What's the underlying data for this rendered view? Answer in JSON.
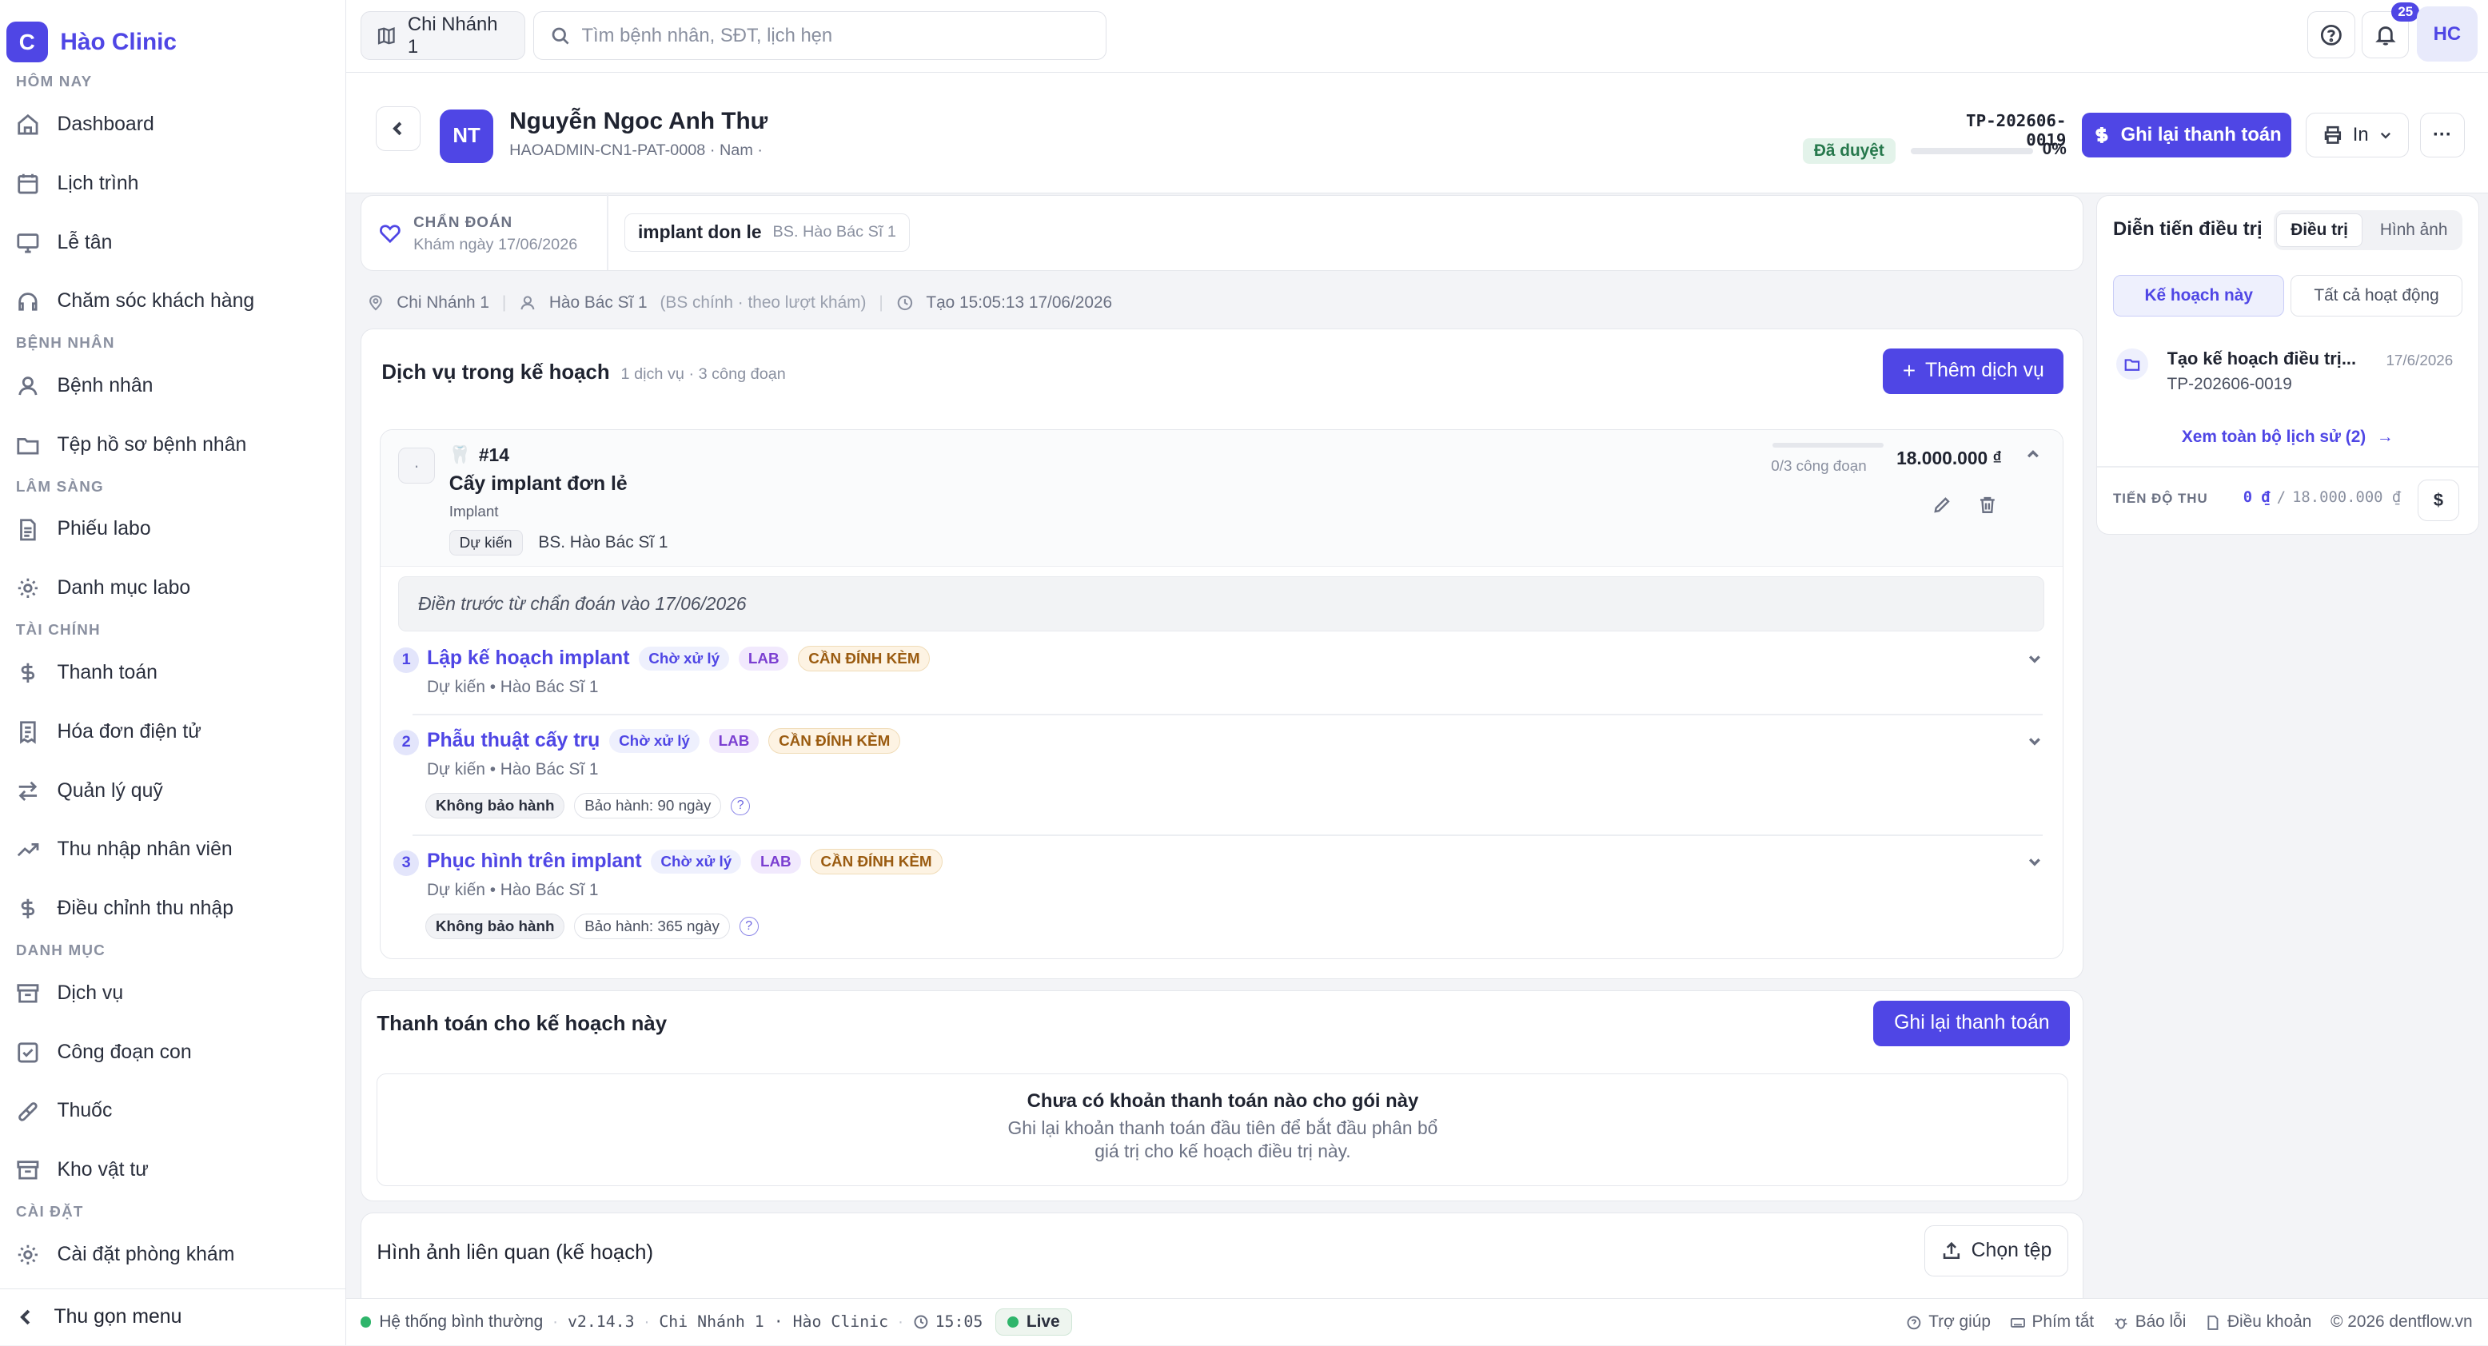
{
  "app": {
    "logo_letter": "C",
    "name": "Hào Clinic"
  },
  "sidebar": {
    "sections": [
      {
        "title": "HÔM NAY",
        "items": [
          {
            "label": "Dashboard",
            "icon": "home-icon"
          },
          {
            "label": "Lịch trình",
            "icon": "calendar-icon"
          },
          {
            "label": "Lễ tân",
            "icon": "monitor-icon"
          },
          {
            "label": "Chăm sóc khách hàng",
            "icon": "headset-icon"
          }
        ]
      },
      {
        "title": "BỆNH NHÂN",
        "items": [
          {
            "label": "Bệnh nhân",
            "icon": "user-icon"
          },
          {
            "label": "Tệp hồ sơ bệnh nhân",
            "icon": "folder-icon"
          }
        ]
      },
      {
        "title": "LÂM SÀNG",
        "items": [
          {
            "label": "Phiếu labo",
            "icon": "file-icon"
          },
          {
            "label": "Danh mục labo",
            "icon": "gear-icon"
          }
        ]
      },
      {
        "title": "TÀI CHÍNH",
        "items": [
          {
            "label": "Thanh toán",
            "icon": "dollar-icon"
          },
          {
            "label": "Hóa đơn điện tử",
            "icon": "receipt-icon"
          },
          {
            "label": "Quản lý quỹ",
            "icon": "transfer-icon"
          },
          {
            "label": "Thu nhập nhân viên",
            "icon": "trend-icon"
          },
          {
            "label": "Điều chỉnh thu nhập",
            "icon": "dollar-icon"
          }
        ]
      },
      {
        "title": "DANH MỤC",
        "items": [
          {
            "label": "Dịch vụ",
            "icon": "archive-icon"
          },
          {
            "label": "Công đoạn con",
            "icon": "checkbox-icon"
          },
          {
            "label": "Thuốc",
            "icon": "pill-icon"
          },
          {
            "label": "Kho vật tư",
            "icon": "archive-icon"
          }
        ]
      },
      {
        "title": "CÀI ĐẶT",
        "items": [
          {
            "label": "Cài đặt phòng khám",
            "icon": "gear-icon"
          }
        ]
      }
    ],
    "collapse_label": "Thu gọn menu"
  },
  "topbar": {
    "branch": "Chi Nhánh 1",
    "search_placeholder": "Tìm bệnh nhân, SĐT, lịch hẹn",
    "notifications": "25",
    "user_initials": "HC"
  },
  "patient": {
    "initials": "NT",
    "name": "Nguyễn Ngoc Anh Thư",
    "sub": "HAOADMIN-CN1-PAT-0008 · Nam ·",
    "plan_code": "TP-202606-0019",
    "status": "Đã duyệt",
    "progress": 0,
    "progress_label": "0%",
    "record_payment_label": "Ghi lại thanh toán",
    "print_label": "In"
  },
  "diagnosis": {
    "label": "CHẨN ĐOÁN",
    "date": "Khám ngày 17/06/2026",
    "name": "implant don le",
    "doctor": "BS. Hào Bác Sĩ 1"
  },
  "meta": {
    "branch": "Chi Nhánh 1",
    "doctor": "Hào Bác Sĩ 1",
    "doctor_note": "(BS chính · theo lượt khám)",
    "created": "Tạo 15:05:13 17/06/2026"
  },
  "services": {
    "title": "Dịch vụ trong kế hoạch",
    "summary": "1 dịch vụ · 3 công đoạn",
    "add_label": "Thêm dịch vụ",
    "item": {
      "handle": "·",
      "tooth_no": "#14",
      "name": "Cấy implant đơn lẻ",
      "category": "Implant",
      "status": "Dự kiến",
      "doctor": "BS. Hào Bác Sĩ 1",
      "stages_done": "0/3 công đoạn",
      "stage_progress": 0,
      "price": "18.000.000",
      "currency": "₫",
      "note": "Điền trước từ chẩn đoán vào 17/06/2026"
    },
    "stages": [
      {
        "num": "1",
        "name": "Lập kế hoạch implant",
        "status": "Chờ xử lý",
        "lab": "LAB",
        "attach": "CẦN ĐÍNH KÈM",
        "sub": "Dự kiến • Hào Bác Sĩ 1",
        "warranty": null,
        "warranty_days": null
      },
      {
        "num": "2",
        "name": "Phẫu thuật cấy trụ",
        "status": "Chờ xử lý",
        "lab": "LAB",
        "attach": "CẦN ĐÍNH KÈM",
        "sub": "Dự kiến • Hào Bác Sĩ 1",
        "warranty": "Không bảo hành",
        "warranty_days": "Bảo hành: 90 ngày"
      },
      {
        "num": "3",
        "name": "Phục hình trên implant",
        "status": "Chờ xử lý",
        "lab": "LAB",
        "attach": "CẦN ĐÍNH KÈM",
        "sub": "Dự kiến • Hào Bác Sĩ 1",
        "warranty": "Không bảo hành",
        "warranty_days": "Bảo hành: 365 ngày"
      }
    ]
  },
  "payments": {
    "title": "Thanh toán cho kế hoạch này",
    "button": "Ghi lại thanh toán",
    "empty_title": "Chưa có khoản thanh toán nào cho gói này",
    "empty_line1": "Ghi lại khoản thanh toán đầu tiên để bắt đầu phân bổ",
    "empty_line2": "giá trị cho kế hoạch điều trị này."
  },
  "images": {
    "title": "Hình ảnh liên quan (kế hoạch)",
    "button": "Chọn tệp"
  },
  "progress_panel": {
    "title": "Diễn tiến điều trị",
    "tabs": [
      "Điều trị",
      "Hình ảnh"
    ],
    "filters": [
      "Kế hoạch này",
      "Tất cả hoạt động"
    ],
    "event_title": "Tạo kế hoạch điều trị...",
    "event_date": "17/6/2026",
    "event_code": "TP-202606-0019",
    "history_link": "Xem toàn bộ lịch sử (2)",
    "revenue_label": "TIẾN ĐỘ THU",
    "revenue_paid": "0 ₫",
    "revenue_sep": "/",
    "revenue_total": "18.000.000 ₫"
  },
  "footer": {
    "status": "Hệ thống bình thường",
    "version": "v2.14.3",
    "branch_clinic": "Chi Nhánh 1 · Hào Clinic",
    "time": "15:05",
    "live": "Live",
    "links": [
      "Trợ giúp",
      "Phím tắt",
      "Báo lỗi",
      "Điều khoản"
    ],
    "copyright": "© 2026 dentflow.vn"
  },
  "colors": {
    "accent": "#4f46e5",
    "success": "#2fb56b",
    "status_bg": "#e3f3ea"
  }
}
